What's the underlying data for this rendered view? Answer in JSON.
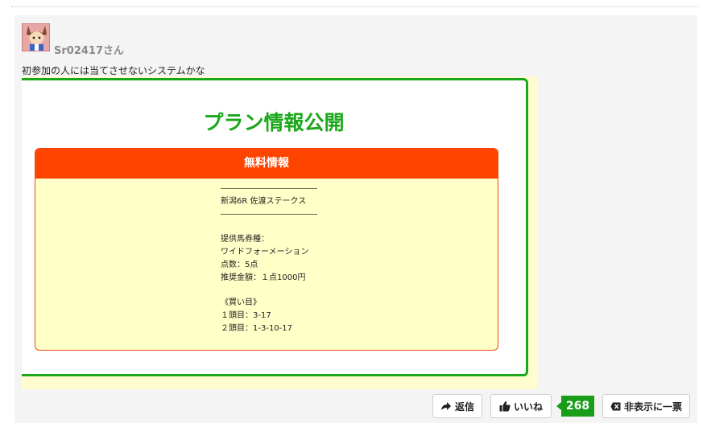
{
  "comment": {
    "username": "Sr02417さん",
    "text": "初参加の人には当てさせないシステムかな"
  },
  "embed": {
    "title": "プラン情報公開",
    "box_header": "無料情報",
    "lines": [
      "――――――――――――",
      "新潟6R 佐渡ステークス",
      "――――――――――――",
      "",
      "提供馬券種：",
      "ワイドフォーメーション",
      "点数：5点",
      "推奨金額：１点1000円",
      "",
      "《買い目》",
      "１頭目：3-17",
      "２頭目：1-3-10-17"
    ]
  },
  "actions": {
    "reply_label": "返信",
    "like_label": "いいね",
    "like_count": "268",
    "hide_label": "非表示に一票"
  },
  "colors": {
    "accent_green": "#1aa81a",
    "header_orange": "#ff4400",
    "box_bg": "#ffffc8"
  },
  "icons": {
    "reply": "reply-arrow-icon",
    "like": "thumbs-up-icon",
    "hide": "hide-x-icon"
  }
}
